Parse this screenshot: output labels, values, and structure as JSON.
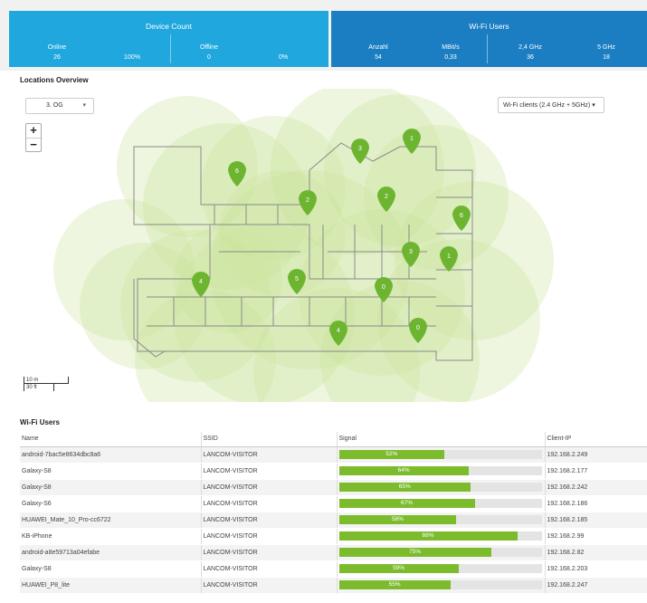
{
  "device_count": {
    "title": "Device Count",
    "online_label": "Online",
    "offline_label": "Offline",
    "online_count": "26",
    "online_pct": "100%",
    "offline_count": "0",
    "offline_pct": "0%"
  },
  "wifi_summary": {
    "title": "Wi-Fi Users",
    "anzahl_label": "Anzahl",
    "mbits_label": "MBit/s",
    "ghz24_label": "2,4 GHz",
    "ghz5_label": "5 GHz",
    "anzahl": "54",
    "mbits": "0,33",
    "ghz24": "36",
    "ghz5": "18"
  },
  "overview": {
    "title": "Locations Overview",
    "floor": "3. OG",
    "metric": "Wi-Fi clients (2.4 GHz + 5GHz)",
    "zoom_in": "+",
    "zoom_out": "−",
    "scale_m": "10 m",
    "scale_ft": "30 ft",
    "pin_color": "#6db530",
    "coverage_color": "#c9e49b",
    "access_points": [
      {
        "count": "6"
      },
      {
        "count": "3"
      },
      {
        "count": "1"
      },
      {
        "count": "2"
      },
      {
        "count": "2"
      },
      {
        "count": "6"
      },
      {
        "count": "3"
      },
      {
        "count": "1"
      },
      {
        "count": "4"
      },
      {
        "count": "5"
      },
      {
        "count": "0"
      },
      {
        "count": "4"
      },
      {
        "count": "0"
      }
    ]
  },
  "wifi_users": {
    "title": "Wi-Fi Users",
    "columns": [
      "Name",
      "SSID",
      "Signal",
      "Client-IP"
    ],
    "rows": [
      {
        "name": "android-7bac5e8634dbc8a6",
        "ssid": "LANCOM-VISITOR",
        "signal": 52,
        "signal_label": "52%",
        "ip": "192.168.2.249"
      },
      {
        "name": "Galaxy-S8",
        "ssid": "LANCOM-VISITOR",
        "signal": 64,
        "signal_label": "64%",
        "ip": "192.168.2.177"
      },
      {
        "name": "Galaxy-S8",
        "ssid": "LANCOM-VISITOR",
        "signal": 65,
        "signal_label": "65%",
        "ip": "192.168.2.242"
      },
      {
        "name": "Galaxy-S6",
        "ssid": "LANCOM-VISITOR",
        "signal": 67,
        "signal_label": "67%",
        "ip": "192.168.2.186"
      },
      {
        "name": "HUAWEI_Mate_10_Pro-cc6722",
        "ssid": "LANCOM-VISITOR",
        "signal": 58,
        "signal_label": "58%",
        "ip": "192.168.2.185"
      },
      {
        "name": "KB-iPhone",
        "ssid": "LANCOM-VISITOR",
        "signal": 88,
        "signal_label": "88%",
        "ip": "192.168.2.99"
      },
      {
        "name": "android-a8e59713a04efabe",
        "ssid": "LANCOM-VISITOR",
        "signal": 75,
        "signal_label": "75%",
        "ip": "192.168.2.82"
      },
      {
        "name": "Galaxy-S8",
        "ssid": "LANCOM-VISITOR",
        "signal": 59,
        "signal_label": "59%",
        "ip": "192.168.2.203"
      },
      {
        "name": "HUAWEI_P8_lite",
        "ssid": "LANCOM-VISITOR",
        "signal": 55,
        "signal_label": "55%",
        "ip": "192.168.2.247"
      }
    ]
  }
}
